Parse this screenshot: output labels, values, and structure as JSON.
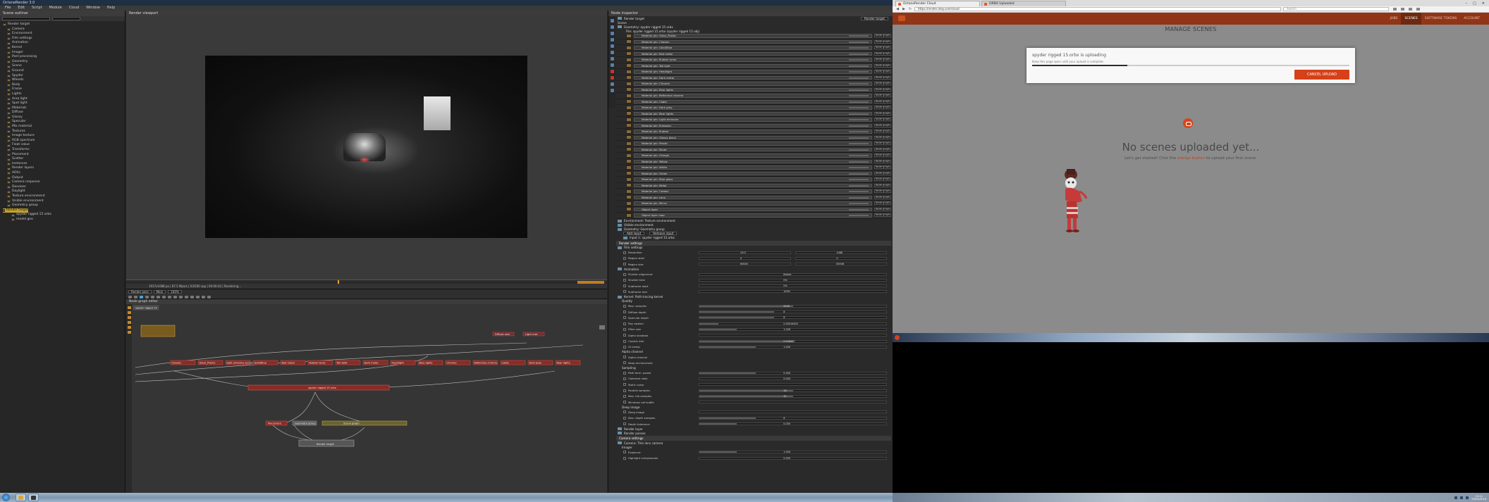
{
  "octane": {
    "title": "OctaneRender 3.0",
    "menu": [
      "File",
      "Edit",
      "Script",
      "Module",
      "Cloud",
      "Window",
      "Help"
    ],
    "outliner_tab": "Scene outliner",
    "outliner_items": [
      "Render target",
      "Camera",
      "Environment",
      "Film settings",
      "Animation",
      "Kernel",
      "Imager",
      "Post processing",
      "Geometry",
      "Scene",
      "Ground",
      "Spyder",
      "Wheels",
      "Body",
      "Frame",
      "Lights",
      "Area light",
      "Spot light",
      "Materials",
      "Diffuse",
      "Glossy",
      "Specular",
      "Mix material",
      "Textures",
      "Image texture",
      "RGB spectrum",
      "Float value",
      "Transforms",
      "Placement",
      "Scatter",
      "Instances",
      "Render layers",
      "AOVs",
      "Output",
      "Camera response",
      "Denoiser",
      "Daylight",
      "Texture environment",
      "Visible environment",
      "Geometry group",
      "Render target",
      "spyder rigged 15 orbx",
      "model.geo"
    ],
    "selected_outliner_index": 40,
    "viewer_tab": "Render viewport",
    "viewer_status": "1917x1088 px | 87.5 Mpx/s | 63/500 spp | 00:00:42 | Rendering...",
    "render_toolbar": {
      "layer_label": "Render pass",
      "zoom_label": "100%",
      "mode_label": "Main"
    },
    "nodegraph_tab": "Node graph editor",
    "graph_breadcrumb": "spyder rigged 15",
    "graph_nodes": {
      "geometry_row": [
        "Chassis",
        "Glass_Plastic",
        "light emissive second wheel",
        "Gold/Blue",
        "Red metal",
        "Rubber tyres",
        "Tail light",
        "Dark metal",
        "Headlight",
        "Blue lights",
        "Chrome",
        "Reflective chrome",
        "Cable",
        "Dark grey",
        "Rear lights"
      ],
      "main_geo": "spyder rigged 15 orbx",
      "scene_node": "Scene graph",
      "geo_group": "Geometry group",
      "placement": "Placement",
      "render_target": "Render target",
      "material_a": "Diffuse mat",
      "material_b": "Light mat"
    },
    "inspector": {
      "tab": "Node inspector",
      "target_dropdown": "Render target",
      "scene_label": "Scene",
      "mesh_header": "Geometry: spyder rigged 15 orbx",
      "mesh_subheader": "File: spyder rigged 15.orbx (spyder rigged 15.obj)",
      "material_pins": [
        "Material pin: Glass_Plastic",
        "Material pin: Chassis",
        "Material pin: Gold/Blue",
        "Material pin: Red metal",
        "Material pin: Rubber tyres",
        "Material pin: Tail light",
        "Material pin: Headlight",
        "Material pin: Dark metal",
        "Material pin: Chrome",
        "Material pin: Blue lights",
        "Material pin: Reflective chrome",
        "Material pin: Cable",
        "Material pin: Dark grey",
        "Material pin: Rear lights",
        "Material pin: Light emissive",
        "Material pin: Emission",
        "Material pin: Rubber",
        "Material pin: Glossy black",
        "Material pin: Plastic",
        "Material pin: Silver",
        "Material pin: Orange",
        "Material pin: Yellow",
        "Material pin: White",
        "Material pin: Green",
        "Material pin: Blue glass",
        "Material pin: Metal",
        "Material pin: Carbon",
        "Material pin: Lens",
        "Material pin: Mirror",
        "Object layer",
        "Object layer map"
      ],
      "pin_value": "Node graph",
      "environment_header": "Environment: Texture environment",
      "visible_env": "Visible environment",
      "geometry_group_header": "Geometry: Geometry group",
      "add_input": "Add input",
      "remove_input": "Remove input",
      "input_1": "Input 1: spyder rigged 15.orbx",
      "render_settings": "Render settings",
      "film_settings": "Film settings",
      "film_params": [
        {
          "name": "Resolution",
          "a": "1917",
          "b": "1088"
        },
        {
          "name": "Region start",
          "a": "0",
          "b": "0"
        },
        {
          "name": "Region size",
          "a": "65536",
          "b": "65536"
        }
      ],
      "animation": "Animation",
      "imager_params": [
        {
          "name": "Shutter alignment",
          "value": "Before"
        },
        {
          "name": "Shutter time",
          "value": "0%"
        },
        {
          "name": "Subframe start",
          "value": "0%"
        },
        {
          "name": "Subframe end",
          "value": "100%"
        }
      ],
      "kernel_header": "Kernel: Path tracing kernel",
      "quality": "Quality",
      "kernel_params": [
        {
          "name": "Max. samples",
          "value": "5000",
          "fill": 0.5
        },
        {
          "name": "Diffuse depth",
          "value": "8",
          "fill": 0.4
        },
        {
          "name": "Specular depth",
          "value": "8",
          "fill": 0.4
        },
        {
          "name": "Ray epsilon",
          "value": "0.00010000",
          "fill": 0.1
        },
        {
          "name": "Filter size",
          "value": "1.200",
          "fill": 0.2
        },
        {
          "name": "Alpha shadows",
          "value": "",
          "fill": 0
        },
        {
          "name": "Caustic blur",
          "value": "0.200000",
          "fill": 0.5
        },
        {
          "name": "GI clamp",
          "value": "1.000",
          "fill": 0.3
        }
      ],
      "alpha_channel": "Alpha channel",
      "alpha_params": [
        "Alpha channel",
        "Keep environment"
      ],
      "sampling": "Sampling",
      "sampling_params": [
        {
          "name": "Path term. power",
          "value": "0.300",
          "fill": 0.3
        },
        {
          "name": "Coherent ratio",
          "value": "0.000",
          "fill": 0
        },
        {
          "name": "Static noise",
          "value": "",
          "fill": 0
        },
        {
          "name": "Parallel samples",
          "value": "16",
          "fill": 0.5
        },
        {
          "name": "Max. tile samples",
          "value": "32",
          "fill": 0.5
        },
        {
          "name": "Minimize net traffic",
          "value": "",
          "fill": 0
        }
      ],
      "deep_image": "Deep image",
      "deep_params": [
        {
          "name": "Deep image",
          "value": "",
          "fill": 0
        },
        {
          "name": "Max. depth samples",
          "value": "8",
          "fill": 0.3
        },
        {
          "name": "Depth tolerance",
          "value": "0.050",
          "fill": 0.2
        }
      ],
      "render_layer": "Render layer",
      "render_passes": "Render passes",
      "camera_settings": "Camera settings",
      "camera_header": "Camera: Thin lens camera",
      "imager": "Imager",
      "camera_params": [
        {
          "name": "Exposure",
          "value": "1.000",
          "fill": 0.2
        },
        {
          "name": "Highlight compression",
          "value": "0.000",
          "fill": 0
        }
      ]
    },
    "status_bar": "Rendering: 00:00:42 | Samples: 63/500"
  },
  "browser": {
    "tabs": [
      "OctaneRender Cloud",
      "ORBX Uploaded"
    ],
    "window_controls": [
      "–",
      "□",
      "✕"
    ],
    "url": "https://render.otoy.com/cloud",
    "search_placeholder": "Search",
    "site_nav": [
      "JOBS",
      "SCENES",
      "SOFTWARE TOKENS",
      "ACCOUNT"
    ],
    "active_nav": 1,
    "page_title": "MANAGE SCENES",
    "empty_title": "No scenes uploaded yet...",
    "empty_sub_before": "Let's get started! Click the",
    "empty_sub_link": "orange button",
    "empty_sub_after": "to upload your first scene.",
    "modal": {
      "title": "spyder rigged 15.orbx is uploading",
      "subtitle": "Keep this page open until your upload is complete.",
      "progress": 0.3,
      "button": "CANCEL UPLOAD"
    }
  },
  "taskbar": {
    "time": "13:12",
    "date": "20/04/2016"
  },
  "colors": {
    "brand": "#913516",
    "accent": "#d64119",
    "selection": "#c5a329"
  }
}
